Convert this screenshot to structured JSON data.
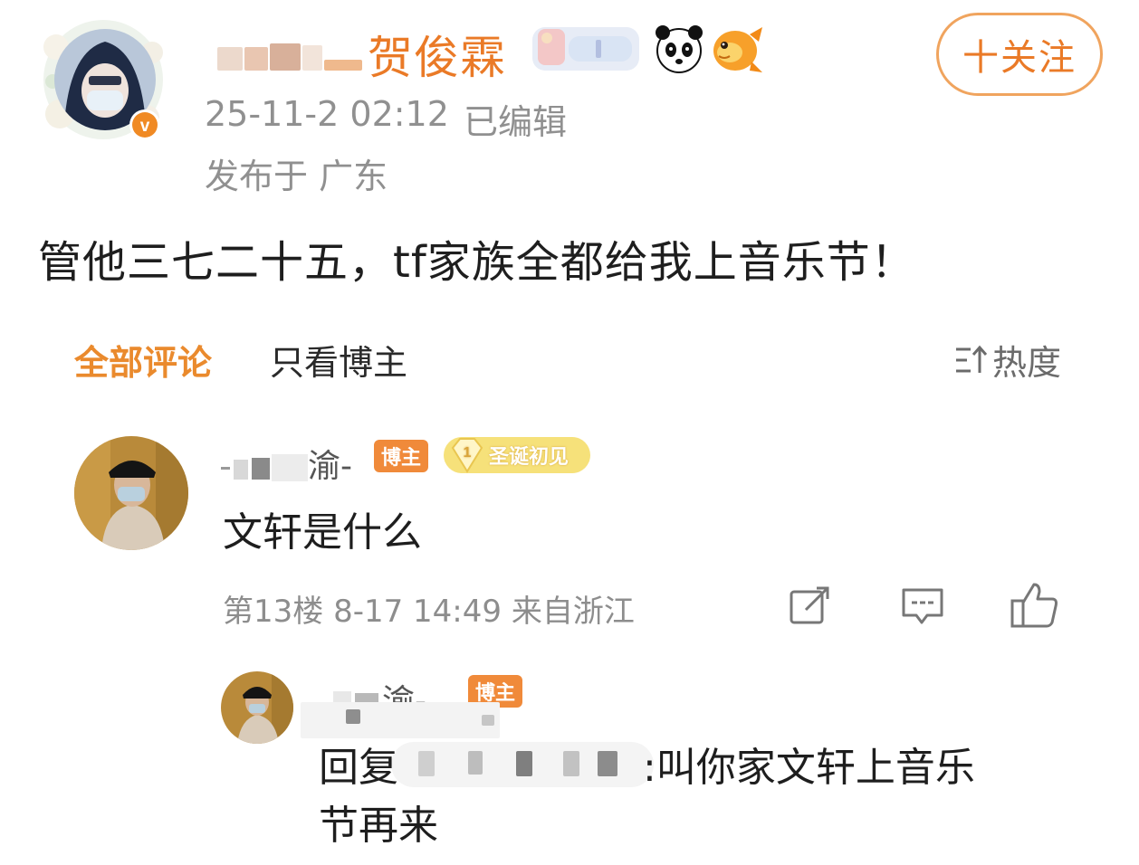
{
  "post": {
    "author_name": "贺俊霖",
    "follow_label": "十关注",
    "time": "25-11-2 02:12",
    "edited": "已编辑",
    "location": "发布于 广东",
    "content": "管他三七二十五，tf家族全都给我上音乐节！",
    "emoji_icons": [
      "panda-icon",
      "goldfish-icon"
    ],
    "verified_color": "#f08a24",
    "accent_color": "#ea7a27"
  },
  "tabs": {
    "all": "全部评论",
    "poster_only": "只看博主",
    "sort": "热度"
  },
  "comments": [
    {
      "name_suffix": "渝-",
      "badge_op": "博主",
      "badge_xmas": "圣诞初见",
      "badge_level": "1",
      "text": "文轩是什么",
      "meta": "第13楼 8-17 14:49 来自浙江"
    }
  ],
  "reply": {
    "name_suffix": "渝-",
    "badge_op": "博主",
    "text_prefix": "回复",
    "text_line1": ":叫你家文轩上音乐",
    "text_line2": "节再来"
  }
}
